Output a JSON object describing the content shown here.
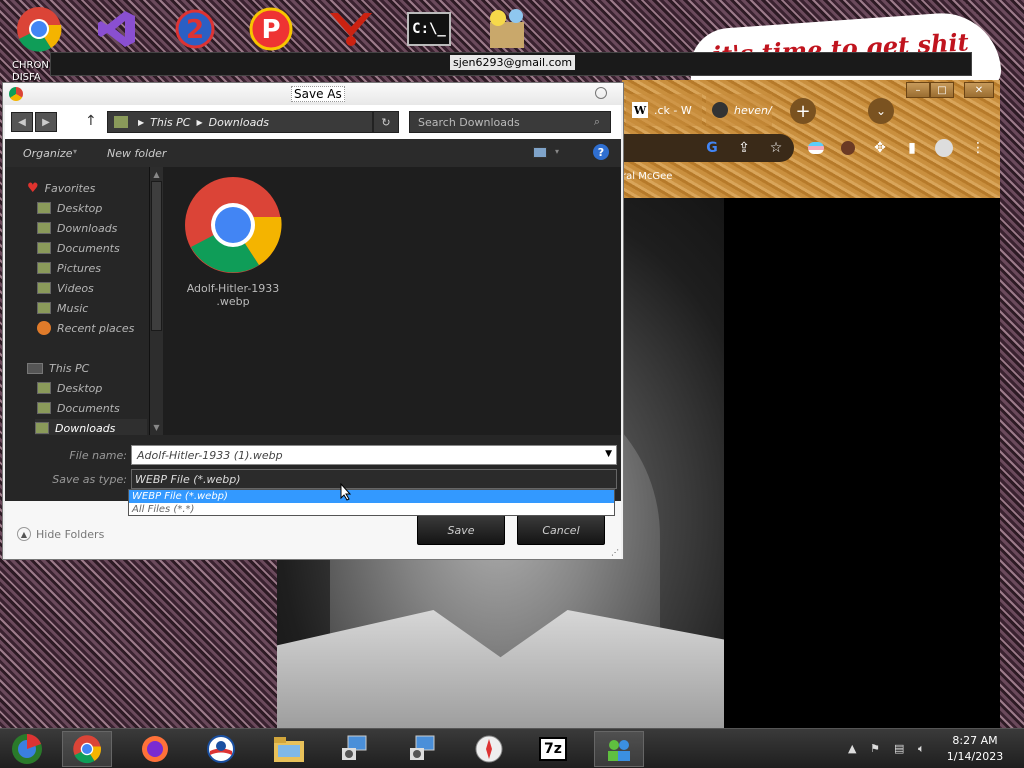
{
  "desktop": {
    "icons": [
      "chrome-icon",
      "visual-studio-icon",
      "numbered-2-icon",
      "p-app-icon",
      "persona-icon",
      "command-prompt-icon",
      "character-app-icon"
    ],
    "chrome_label": "CHRON\nDISFA"
  },
  "banner": {
    "email": "sjen6293@gmail.com",
    "sticker_text": "it's time to get shit"
  },
  "chrome_window": {
    "tabs": [
      ".ck - W",
      "heven/"
    ],
    "bookmark": "ral McGee"
  },
  "dialog": {
    "title": "Save As",
    "address": [
      "This PC",
      "Downloads"
    ],
    "search_placeholder": "Search Downloads",
    "organize": "Organize",
    "new_folder": "New folder",
    "nav": {
      "favorites": "Favorites",
      "fav_items": [
        "Desktop",
        "Downloads",
        "Documents",
        "Pictures",
        "Videos",
        "Music",
        "Recent places"
      ],
      "this_pc": "This PC",
      "pc_items": [
        "Desktop",
        "Documents",
        "Downloads"
      ]
    },
    "file": {
      "name_line1": "Adolf-Hitler-1933",
      "name_line2": ".webp"
    },
    "file_name_label": "File name:",
    "file_name_value": "Adolf-Hitler-1933 (1).webp",
    "save_type_label": "Save as type:",
    "save_type_value": "WEBP File (*.webp)",
    "save_type_options": [
      "WEBP File (*.webp)",
      "All Files (*.*)"
    ],
    "hide_folders": "Hide Folders",
    "save": "Save",
    "cancel": "Cancel"
  },
  "taskbar": {
    "apps": [
      "start-orb-icon",
      "chrome-icon",
      "firefox-icon",
      "obama-logo-icon",
      "file-explorer-icon",
      "network-setup-icon",
      "network-setup-icon",
      "safari-icon",
      "7zip-icon",
      "people-app-icon"
    ],
    "time": "8:27 AM",
    "date": "1/14/2023"
  }
}
